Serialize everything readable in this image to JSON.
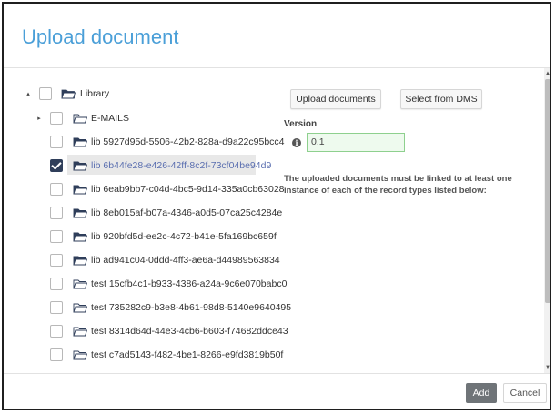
{
  "dialog": {
    "title": "Upload document"
  },
  "tree": {
    "root": {
      "label": "Library",
      "caret": "▴"
    },
    "items": [
      {
        "label": "E-MAILS",
        "caret": "▸",
        "checked": false,
        "folder": "outline"
      },
      {
        "label": "lib 5927d95d-5506-42b2-828a-d9a22c95bcc4",
        "checked": false,
        "folder": "filled"
      },
      {
        "label": "lib 6b44fe28-e426-42ff-8c2f-73cf04be94d9",
        "checked": true,
        "folder": "filled",
        "selected": true
      },
      {
        "label": "lib 6eab9bb7-c04d-4bc5-9d14-335a0cb63028",
        "checked": false,
        "folder": "filled"
      },
      {
        "label": "lib 8eb015af-b07a-4346-a0d5-07ca25c4284e",
        "checked": false,
        "folder": "filled"
      },
      {
        "label": "lib 920bfd5d-ee2c-4c72-b41e-5fa169bc659f",
        "checked": false,
        "folder": "filled"
      },
      {
        "label": "lib ad941c04-0ddd-4ff3-ae6a-d44989563834",
        "checked": false,
        "folder": "filled"
      },
      {
        "label": "test 15cfb4c1-b933-4386-a24a-9c6e070babc0",
        "checked": false,
        "folder": "outline"
      },
      {
        "label": "test 735282c9-b3e8-4b61-98d8-5140e9640495",
        "checked": false,
        "folder": "outline"
      },
      {
        "label": "test 8314d64d-44e3-4cb6-b603-f74682ddce43",
        "checked": false,
        "folder": "outline"
      },
      {
        "label": "test c7ad5143-f482-4be1-8266-e9fd3819b50f",
        "checked": false,
        "folder": "outline"
      }
    ]
  },
  "actions": {
    "upload_label": "Upload documents",
    "dms_label": "Select from DMS"
  },
  "version": {
    "label": "Version",
    "info_icon": "i",
    "value": "0.1"
  },
  "note": "The uploaded documents must be linked to at least one instance of each of the record types listed below:",
  "footer": {
    "add_label": "Add",
    "cancel_label": "Cancel"
  },
  "colors": {
    "title": "#4a9fd8",
    "selected_text": "#5b6fb0",
    "checkbox_checked": "#2f3e5a",
    "version_border": "#8ed08e",
    "add_button": "#6f7478"
  }
}
